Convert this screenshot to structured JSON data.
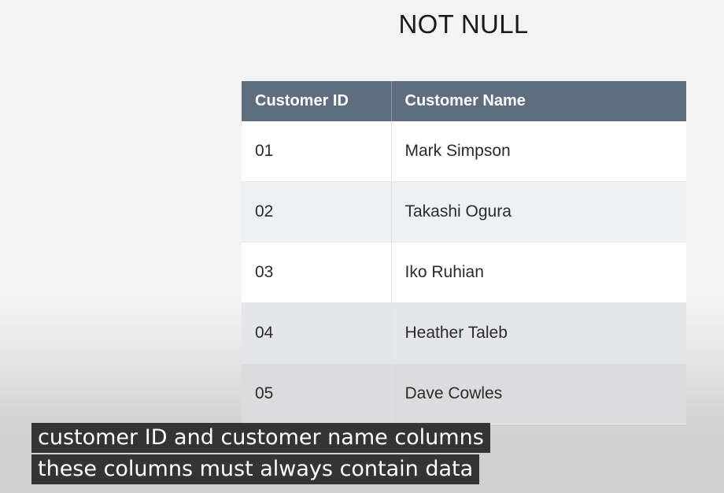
{
  "slide": {
    "title": "NOT NULL"
  },
  "table": {
    "headers": [
      "Customer ID",
      "Customer Name"
    ],
    "rows": [
      [
        "01",
        "Mark Simpson"
      ],
      [
        "02",
        "Takashi Ogura"
      ],
      [
        "03",
        "Iko Ruhian"
      ],
      [
        "04",
        "Heather Taleb"
      ],
      [
        "05",
        "Dave Cowles"
      ]
    ]
  },
  "captions": {
    "line1": "customer ID and customer name columns",
    "line2": "these columns must always contain data"
  }
}
